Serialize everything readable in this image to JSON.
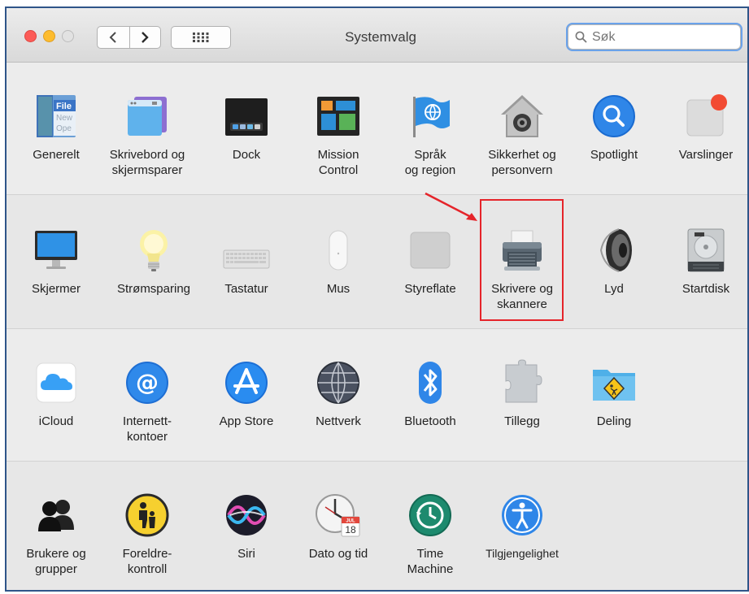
{
  "window": {
    "title": "Systemvalg",
    "search_placeholder": "Søk"
  },
  "icons": {
    "back": "chevron-left-icon",
    "forward": "chevron-right-icon",
    "show_all": "grid-icon",
    "search": "magnifier-icon"
  },
  "highlight_color": "#e5242a",
  "sections": [
    {
      "items": [
        {
          "label": "Generelt",
          "icon": "general-icon"
        },
        {
          "label": "Skrivebord og\nskjermsparer",
          "icon": "desktop-icon"
        },
        {
          "label": "Dock",
          "icon": "dock-icon"
        },
        {
          "label": "Mission\nControl",
          "icon": "mission-control-icon"
        },
        {
          "label": "Språk\nog region",
          "icon": "flag-globe-icon"
        },
        {
          "label": "Sikkerhet og\npersonvern",
          "icon": "house-lock-icon"
        },
        {
          "label": "Spotlight",
          "icon": "spotlight-icon"
        },
        {
          "label": "Varslinger",
          "icon": "notifications-icon"
        }
      ]
    },
    {
      "items": [
        {
          "label": "Skjermer",
          "icon": "display-icon"
        },
        {
          "label": "Strømsparing",
          "icon": "bulb-icon"
        },
        {
          "label": "Tastatur",
          "icon": "keyboard-icon"
        },
        {
          "label": "Mus",
          "icon": "mouse-icon"
        },
        {
          "label": "Styreflate",
          "icon": "trackpad-icon"
        },
        {
          "label": "Skrivere og\nskannere",
          "icon": "printer-icon"
        },
        {
          "label": "Lyd",
          "icon": "speaker-icon"
        },
        {
          "label": "Startdisk",
          "icon": "disk-icon"
        }
      ]
    },
    {
      "items": [
        {
          "label": "iCloud",
          "icon": "cloud-icon"
        },
        {
          "label": "Internett-\nkontoer",
          "icon": "at-icon"
        },
        {
          "label": "App Store",
          "icon": "app-store-icon"
        },
        {
          "label": "Nettverk",
          "icon": "network-globe-icon"
        },
        {
          "label": "Bluetooth",
          "icon": "bluetooth-icon"
        },
        {
          "label": "Tillegg",
          "icon": "puzzle-icon"
        },
        {
          "label": "Deling",
          "icon": "sharing-folder-icon"
        }
      ]
    },
    {
      "items": [
        {
          "label": "Brukere og\ngrupper",
          "icon": "users-icon"
        },
        {
          "label": "Foreldre-\nkontroll",
          "icon": "parental-icon"
        },
        {
          "label": "Siri",
          "icon": "siri-icon"
        },
        {
          "label": "Dato og tid",
          "icon": "clock-calendar-icon"
        },
        {
          "label": "Time\nMachine",
          "icon": "time-machine-icon"
        },
        {
          "label": "Tilgjengelighet",
          "icon": "accessibility-icon"
        }
      ]
    }
  ],
  "date_icon": {
    "month": "JUL",
    "day": "18"
  },
  "general_icon_text": {
    "line1": "File",
    "line2": "New",
    "line3": "Ope"
  }
}
